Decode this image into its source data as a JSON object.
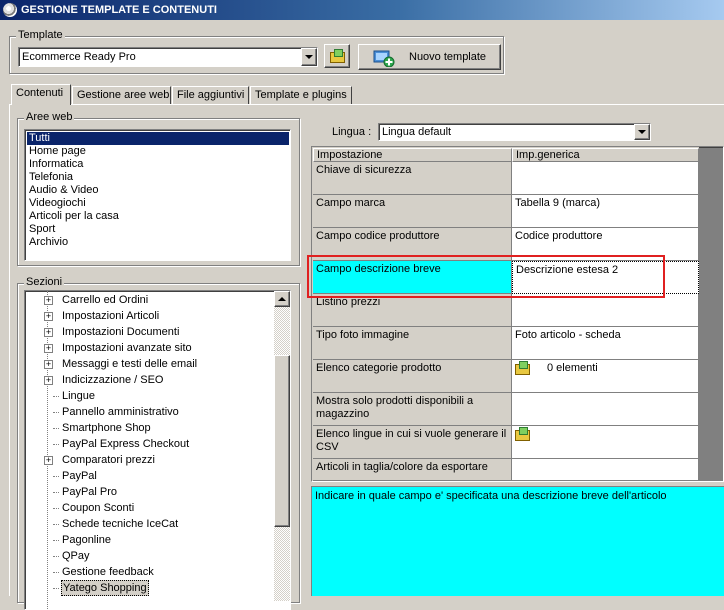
{
  "window": {
    "title": "GESTIONE TEMPLATE E CONTENUTI"
  },
  "template_group": {
    "label": "Template",
    "selected": "Ecommerce Ready Pro",
    "new_button_label": "Nuovo template"
  },
  "tabs": [
    {
      "label": "Contenuti",
      "active": true
    },
    {
      "label": "Gestione aree web",
      "active": false
    },
    {
      "label": "File aggiuntivi",
      "active": false
    },
    {
      "label": "Template e plugins",
      "active": false
    }
  ],
  "aree_web": {
    "label": "Aree web",
    "items": [
      "Tutti",
      "Home page",
      "Informatica",
      "Telefonia",
      "Audio & Video",
      "Videogiochi",
      "Articoli per la casa",
      "Sport",
      "Archivio"
    ],
    "selected_index": 0
  },
  "sezioni": {
    "label": "Sezioni",
    "items": [
      {
        "label": "Carrello ed Ordini",
        "expandable": true
      },
      {
        "label": "Impostazioni Articoli",
        "expandable": true
      },
      {
        "label": "Impostazioni Documenti",
        "expandable": true
      },
      {
        "label": "Impostazioni avanzate sito",
        "expandable": true
      },
      {
        "label": "Messaggi e testi delle email",
        "expandable": true
      },
      {
        "label": "Indicizzazione / SEO",
        "expandable": true
      },
      {
        "label": "Lingue",
        "expandable": false
      },
      {
        "label": "Pannello amministrativo",
        "expandable": false
      },
      {
        "label": "Smartphone Shop",
        "expandable": false
      },
      {
        "label": "PayPal Express Checkout",
        "expandable": false
      },
      {
        "label": "Comparatori prezzi",
        "expandable": true
      },
      {
        "label": "PayPal",
        "expandable": false
      },
      {
        "label": "PayPal Pro",
        "expandable": false
      },
      {
        "label": "Coupon Sconti",
        "expandable": false
      },
      {
        "label": "Schede tecniche IceCat",
        "expandable": false
      },
      {
        "label": "Pagonline",
        "expandable": false
      },
      {
        "label": "QPay",
        "expandable": false
      },
      {
        "label": "Gestione feedback",
        "expandable": false
      },
      {
        "label": "Yatego Shopping",
        "expandable": false,
        "selected": true
      }
    ]
  },
  "lingua": {
    "label": "Lingua :",
    "selected": "Lingua default"
  },
  "grid": {
    "headers": [
      "Impostazione",
      "Imp.generica"
    ],
    "rows": [
      {
        "name": "Chiave di sicurezza",
        "value": ""
      },
      {
        "name": "Campo marca",
        "value": "Tabella 9 (marca)"
      },
      {
        "name": "Campo codice produttore",
        "value": "Codice produttore"
      },
      {
        "name": "Campo descrizione breve",
        "value": "Descrizione estesa 2",
        "highlighted": true
      },
      {
        "name": "Listino prezzi",
        "value": ""
      },
      {
        "name": "Tipo foto immagine",
        "value": "Foto articolo - scheda"
      },
      {
        "name": "Elenco categorie prodotto",
        "value": "0 elementi",
        "icon": "folder-icon"
      },
      {
        "name": "Mostra solo prodotti disponibili a magazzino",
        "value": ""
      },
      {
        "name": "Elenco lingue in cui si vuole generare il CSV",
        "value": "",
        "icon": "folder-icon"
      },
      {
        "name": "Articoli in taglia/colore da esportare",
        "value": ""
      }
    ]
  },
  "description": "Indicare in quale campo e' specificata una descrizione breve dell'articolo",
  "colors": {
    "highlight": "#00ffff",
    "selection": "#0a246a",
    "annotation": "#e02020"
  }
}
